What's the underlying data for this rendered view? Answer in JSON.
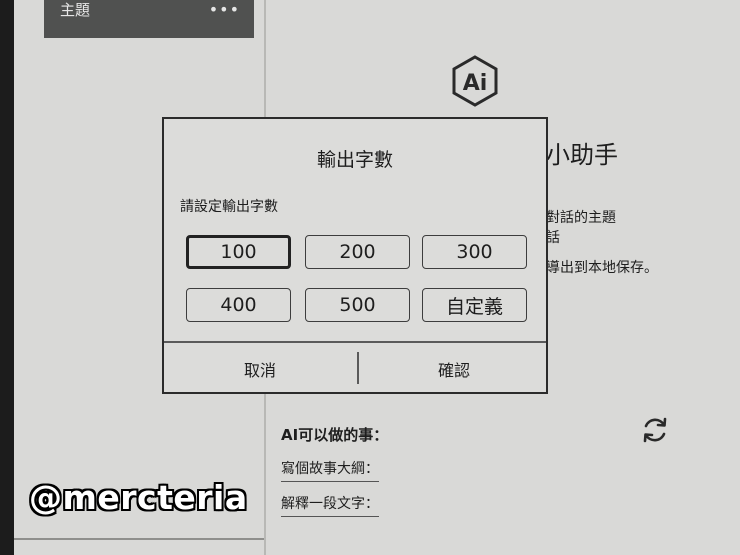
{
  "sidebar": {
    "topic_label": "主題",
    "more_label": "•••"
  },
  "assistant": {
    "logo_text": "Ai",
    "title_fragment": "小助手",
    "desc_lines": [
      "對話的主題",
      "話",
      "導出到本地保存。"
    ]
  },
  "dialog": {
    "title": "輸出字數",
    "subtitle": "請設定輸出字數",
    "options": [
      "100",
      "200",
      "300",
      "400",
      "500",
      "自定義"
    ],
    "selected": "100",
    "cancel": "取消",
    "confirm": "確認"
  },
  "ai_tasks": {
    "heading": "AI可以做的事：",
    "items": [
      "寫個故事大綱：",
      "解釋一段文字："
    ]
  },
  "watermark": "@mercteria"
}
